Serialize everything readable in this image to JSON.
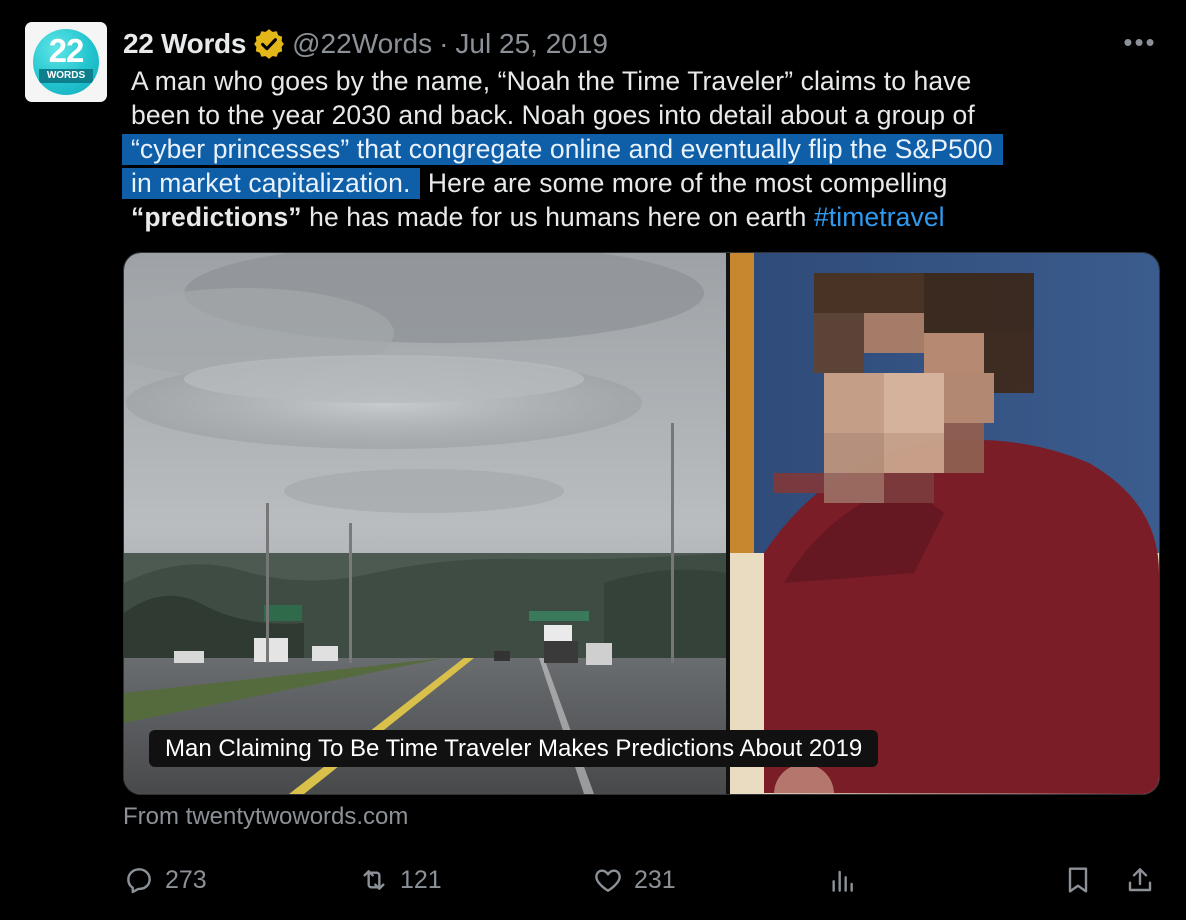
{
  "author": {
    "display_name": "22 Words",
    "handle": "@22Words",
    "separator": "·",
    "date": "Jul 25, 2019",
    "avatar_number": "22",
    "avatar_word": "WORDS"
  },
  "more_label": "•••",
  "tweet": {
    "line1": "A man who goes by the name, “Noah the Time Traveler” claims to have",
    "line2": "been to the year 2030 and back. Noah goes into detail about a group of",
    "line3_highlighted": "“cyber princesses” that congregate online and eventually flip the S&P500",
    "line4_highlighted": "in market capitalization.",
    "line4_rest": " Here are some more of the most compelling",
    "line5_bold": "“predictions”",
    "line5_rest": " he has made for us humans here on earth ",
    "hashtag": "#timetravel"
  },
  "card": {
    "caption": "Man Claiming To Be Time Traveler Makes Predictions About 2019",
    "source": "From twentytwowords.com"
  },
  "actions": {
    "replies": "273",
    "reposts": "121",
    "likes": "231"
  },
  "colors": {
    "background": "#000000",
    "text": "#e7e9ea",
    "muted": "#8b9197",
    "highlight": "#0e5ea8",
    "link": "#2f9bf0",
    "verified": "#e2b719"
  }
}
